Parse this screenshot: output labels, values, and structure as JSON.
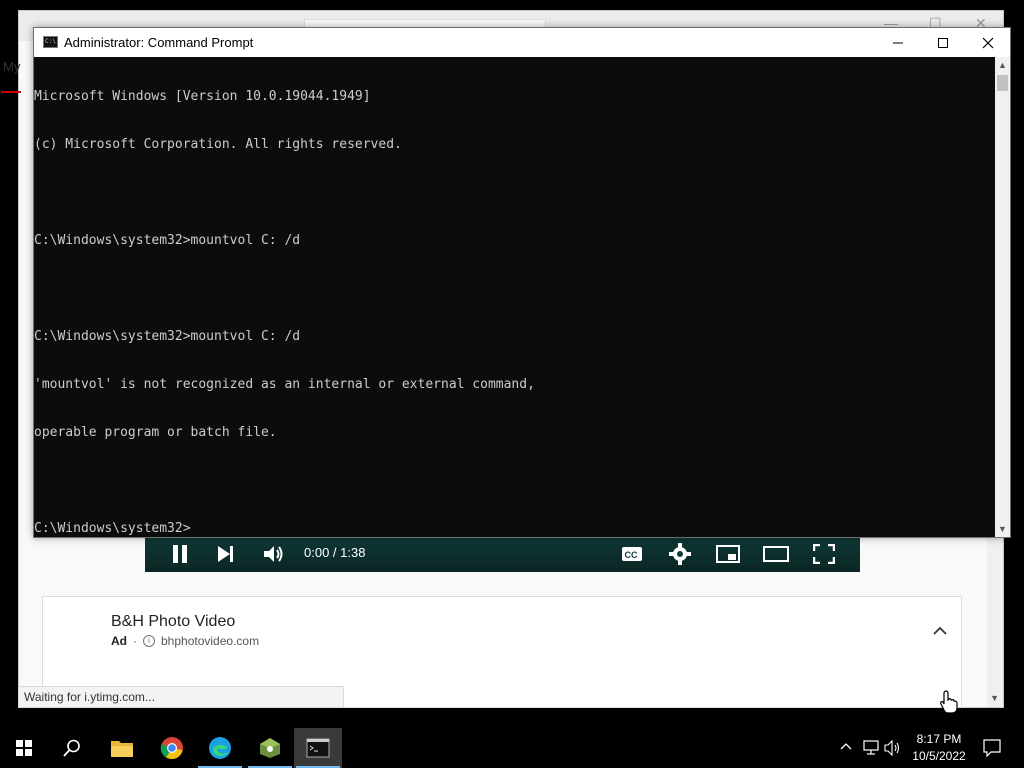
{
  "cmd": {
    "title": "Administrator: Command Prompt",
    "lines": [
      "Microsoft Windows [Version 10.0.19044.1949]",
      "(c) Microsoft Corporation. All rights reserved.",
      "",
      "C:\\Windows\\system32>mountvol C: /d",
      "",
      "C:\\Windows\\system32>mountvol C: /d",
      "'mountvol' is not recognized as an internal or external command,",
      "operable program or batch file.",
      "",
      "C:\\Windows\\system32>"
    ]
  },
  "browser": {
    "left_fragment": "My",
    "status_text": "Waiting for i.ytimg.com...",
    "video": {
      "time": "0:00 / 1:38"
    },
    "ad": {
      "title": "B&H Photo Video",
      "label": "Ad",
      "separator": "·",
      "domain": "bhphotovideo.com"
    }
  },
  "taskbar": {
    "items": [
      "start-icon",
      "search-icon",
      "file-explorer-icon",
      "chrome-icon",
      "edge-icon",
      "app-icon",
      "command-prompt-icon"
    ],
    "clock_time": "8:17 PM",
    "clock_date": "10/5/2022"
  },
  "colors": {
    "console_bg": "#0c0c0c",
    "console_fg": "#cccccc",
    "video_bar": "#0f3a37",
    "taskbar": "#000000",
    "accent": "#76b9ed"
  }
}
